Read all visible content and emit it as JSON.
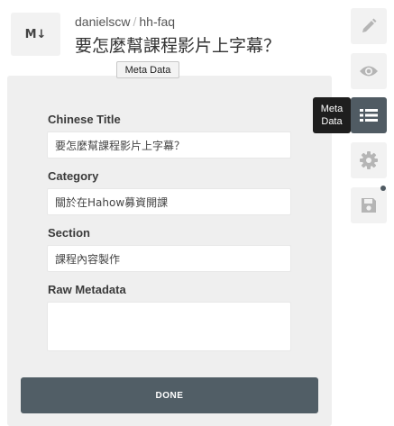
{
  "header": {
    "badge": "M↓",
    "owner": "danielscw",
    "separator": "/",
    "repo": "hh-faq",
    "title": "要怎麼幫課程影片上字幕？"
  },
  "tooltips": {
    "top": "Meta Data",
    "side_line1": "Meta",
    "side_line2": "Data"
  },
  "form": {
    "chinese_title_label": "Chinese Title",
    "chinese_title_value": "要怎麼幫課程影片上字幕？",
    "category_label": "Category",
    "category_value": "關於在Hahow募資開課",
    "section_label": "Section",
    "section_value": "課程內容製作",
    "raw_metadata_label": "Raw Metadata",
    "raw_metadata_value": "",
    "done_label": "DONE"
  },
  "toolbar": {
    "icons": [
      "pencil-icon",
      "eye-icon",
      "list-icon",
      "gear-icon",
      "save-icon"
    ],
    "active": "list-icon"
  },
  "colors": {
    "active_tool": "#505b63",
    "button": "#515e66",
    "panel": "#efefef"
  }
}
